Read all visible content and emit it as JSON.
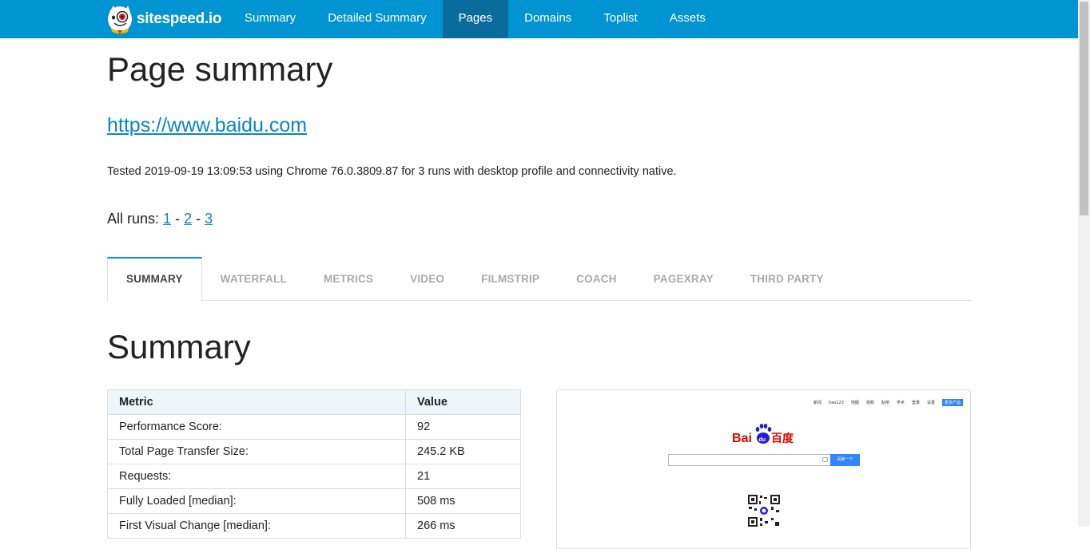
{
  "nav": {
    "brand": "sitespeed.io",
    "items": [
      {
        "label": "Summary",
        "active": false
      },
      {
        "label": "Detailed Summary",
        "active": false
      },
      {
        "label": "Pages",
        "active": true
      },
      {
        "label": "Domains",
        "active": false
      },
      {
        "label": "Toplist",
        "active": false
      },
      {
        "label": "Assets",
        "active": false
      }
    ]
  },
  "page": {
    "title": "Page summary",
    "url": "https://www.baidu.com",
    "tested": "Tested 2019-09-19 13:09:53 using Chrome 76.0.3809.87 for 3 runs with desktop profile and connectivity native.",
    "runs_label": "All runs:",
    "runs": [
      "1",
      "2",
      "3"
    ],
    "runs_separator": " - "
  },
  "tabs": [
    {
      "label": "SUMMARY",
      "active": true
    },
    {
      "label": "WATERFALL",
      "active": false
    },
    {
      "label": "METRICS",
      "active": false
    },
    {
      "label": "VIDEO",
      "active": false
    },
    {
      "label": "FILMSTRIP",
      "active": false
    },
    {
      "label": "COACH",
      "active": false
    },
    {
      "label": "PAGEXRAY",
      "active": false
    },
    {
      "label": "THIRD PARTY",
      "active": false
    }
  ],
  "summary": {
    "title": "Summary",
    "columns": [
      "Metric",
      "Value"
    ],
    "rows": [
      [
        "Performance Score:",
        "92"
      ],
      [
        "Total Page Transfer Size:",
        "245.2 KB"
      ],
      [
        "Requests:",
        "21"
      ],
      [
        "Fully Loaded [median]:",
        "508 ms"
      ],
      [
        "First Visual Change [median]:",
        "266 ms"
      ]
    ]
  },
  "screenshot": {
    "nav_links": [
      "新闻",
      "hao123",
      "地图",
      "视频",
      "贴吧",
      "学术",
      "登录",
      "设置"
    ],
    "nav_button": "更多产品",
    "logo_text_left": "Bai",
    "logo_text_paw": "du",
    "logo_text_right": "百度",
    "search_button": "百度一下"
  },
  "colors": {
    "navbar": "#0095d2",
    "navbar_active": "#0a6c9d",
    "link": "#0a87be",
    "baidu_red": "#e10601",
    "baidu_blue": "#2319dc"
  }
}
